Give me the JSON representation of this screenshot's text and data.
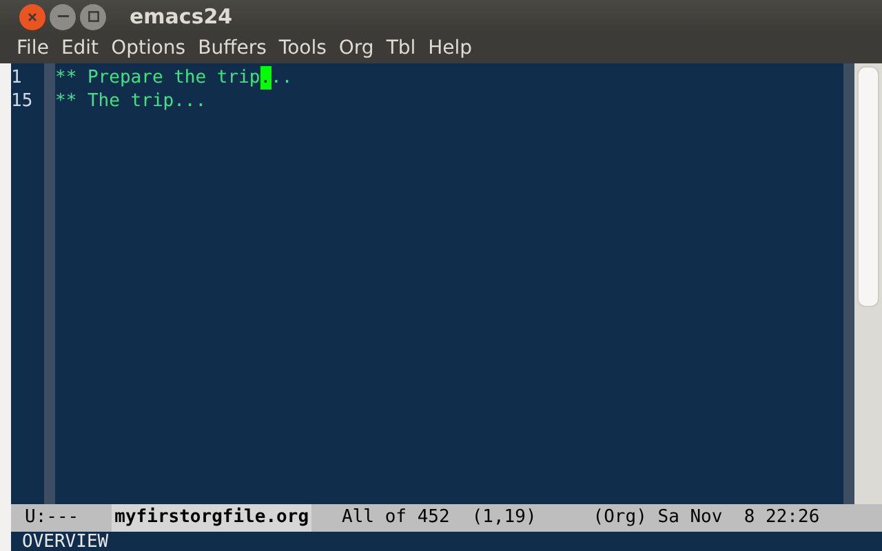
{
  "window": {
    "title": "emacs24"
  },
  "menu": [
    "File",
    "Edit",
    "Options",
    "Buffers",
    "Tools",
    "Org",
    "Tbl",
    "Help"
  ],
  "lines": [
    {
      "number": "1",
      "kind": "cursor",
      "before": "** Prepare the trip",
      "cursor": ".",
      "after": ".."
    },
    {
      "number": "15",
      "kind": "plain",
      "text": "** The trip..."
    }
  ],
  "mode_line": {
    "status": "U:---",
    "buffer": "myfirstorgfile.org",
    "position": "All of 452",
    "coords": "(1,19)",
    "info": "(Org) Sa Nov  8 22:26"
  },
  "minibuffer": "OVERVIEW"
}
